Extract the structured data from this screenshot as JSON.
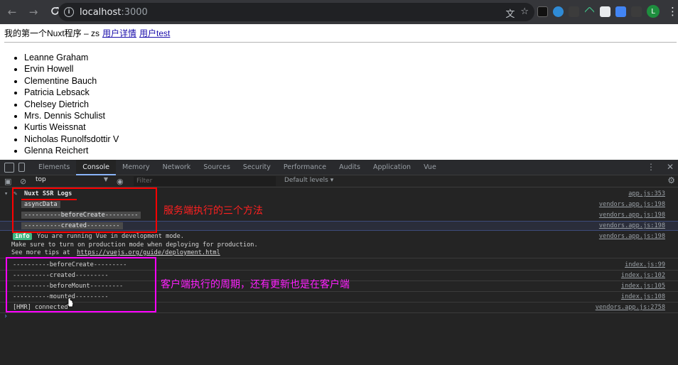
{
  "browser": {
    "back_icon": "←",
    "forward_icon": "→",
    "reload_icon": "C",
    "url_host": "localhost",
    "url_port": ":3000",
    "translate_icon": "文",
    "star_icon": "☆",
    "profile_initial": "L",
    "menu_icon": "⋮"
  },
  "page": {
    "title": "我的第一个Nuxt程序 – zs",
    "links": [
      "用户详情",
      "用户test"
    ],
    "users": [
      "Leanne Graham",
      "Ervin Howell",
      "Clementine Bauch",
      "Patricia Lebsack",
      "Chelsey Dietrich",
      "Mrs. Dennis Schulist",
      "Kurtis Weissnat",
      "Nicholas Runolfsdottir V",
      "Glenna Reichert"
    ]
  },
  "devtools": {
    "tabs": [
      "Elements",
      "Console",
      "Memory",
      "Network",
      "Sources",
      "Security",
      "Performance",
      "Audits",
      "Application",
      "Vue"
    ],
    "active_tab": "Console",
    "context": "top",
    "filter_placeholder": "Filter",
    "levels": "Default levels ▾",
    "more_icon": "⋮",
    "close_icon": "✕",
    "gear_icon": "⚙"
  },
  "console": {
    "group_title": "Nuxt SSR Logs",
    "group_src": "app.js:353",
    "server_logs": [
      {
        "text": "asyncData",
        "src": "vendors.app.js:198"
      },
      {
        "text": "----------beforeCreate---------",
        "src": "vendors.app.js:198"
      },
      {
        "text": "----------created---------",
        "src": "vendors.app.js:198"
      }
    ],
    "info_tag": "info",
    "info_line1": "You are running Vue in development mode.",
    "info_line2": "Make sure to turn on production mode when deploying for production.",
    "info_line3_prefix": "See more tips at ",
    "info_line3_link": "https://vuejs.org/guide/deployment.html",
    "info_src": "vendors.app.js:198",
    "client_logs": [
      {
        "text": "----------beforeCreate---------",
        "src": "index.js:99"
      },
      {
        "text": "----------created---------",
        "src": "index.js:102"
      },
      {
        "text": "----------beforeMount---------",
        "src": "index.js:105"
      },
      {
        "text": "----------mounted---------",
        "src": "index.js:108"
      }
    ],
    "hmr_text": "[HMR] connected",
    "hmr_src": "vendors.app.js:2758",
    "prompt": "›"
  },
  "annotations": {
    "server": "服务端执行的三个方法",
    "client": "客户端执行的周期，还有更新也是在客户端",
    "server_color": "#ff0000",
    "client_color": "#ff00ff"
  }
}
